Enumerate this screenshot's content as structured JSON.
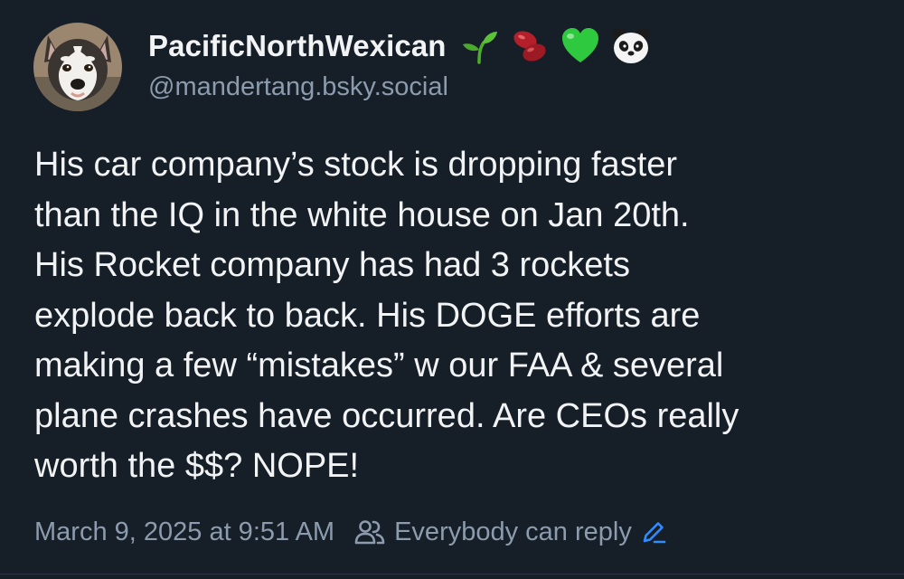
{
  "author": {
    "display_name": "PacificNorthWexican",
    "handle": "@mandertang.bsky.social",
    "avatar_icon": "husky-dog-avatar",
    "name_emojis": [
      "seedling-emoji",
      "beans-emoji",
      "green-heart-emoji",
      "panda-emoji"
    ]
  },
  "post": {
    "text": "His car company’s stock is dropping faster\nthan the IQ in the white house on Jan 20th.\nHis Rocket company has had 3 rockets\nexplode back to back. His DOGE efforts are\nmaking a few “mistakes” w our FAA & several\nplane crashes have occurred. Are CEOs really\nworth the $$? NOPE!"
  },
  "meta": {
    "timestamp": "March 9, 2025 at 9:51 AM",
    "reply_setting": "Everybody can reply",
    "reply_icon": "people-icon",
    "edit_icon": "pencil-icon"
  },
  "colors": {
    "background": "#161e27",
    "text": "#f1f3f5",
    "muted": "#8c9bad",
    "accent": "#2f8bff"
  }
}
